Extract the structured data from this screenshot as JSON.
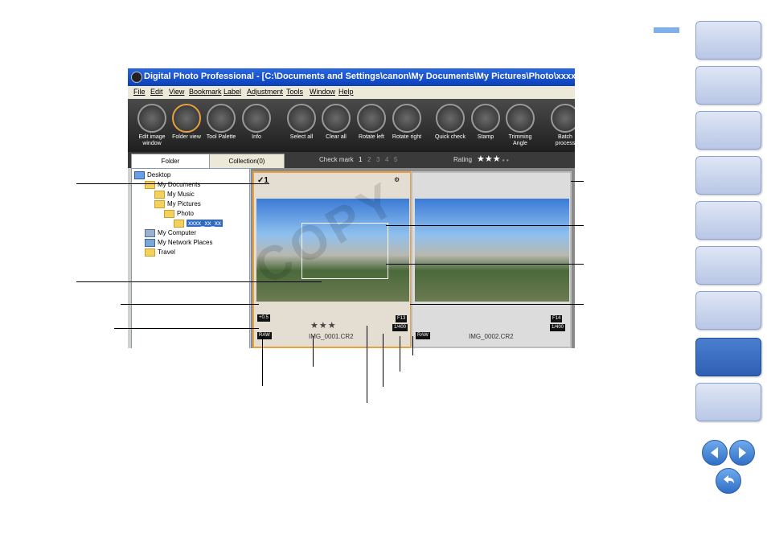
{
  "window": {
    "title": "Digital Photo Professional - [C:\\Documents and Settings\\canon\\My Documents\\My Pictures\\Photo\\xxxx_xx_xx]"
  },
  "menu": [
    "File",
    "Edit",
    "View",
    "Bookmark",
    "Label",
    "Adjustment",
    "Tools",
    "Window",
    "Help"
  ],
  "toolbar": [
    {
      "label": "Edit image window",
      "icon": "edit-image-icon"
    },
    {
      "label": "Folder view",
      "icon": "folder-view-icon",
      "selected": true
    },
    {
      "label": "Tool Palette",
      "icon": "tool-palette-icon"
    },
    {
      "label": "Info",
      "icon": "info-icon"
    },
    {
      "label": "Select all",
      "icon": "select-all-icon"
    },
    {
      "label": "Clear all",
      "icon": "clear-all-icon"
    },
    {
      "label": "Rotate left",
      "icon": "rotate-left-icon"
    },
    {
      "label": "Rotate right",
      "icon": "rotate-right-icon"
    },
    {
      "label": "Quick check",
      "icon": "quick-check-icon"
    },
    {
      "label": "Stamp",
      "icon": "stamp-icon"
    },
    {
      "label": "Trimming Angle",
      "icon": "trimming-angle-icon"
    },
    {
      "label": "Batch process",
      "icon": "batch-process-icon"
    }
  ],
  "tabs": {
    "folder": "Folder",
    "collection": "Collection(0)"
  },
  "filters": {
    "check_mark_label": "Check mark",
    "rating_label": "Rating",
    "check_marks": [
      "1",
      "2",
      "3",
      "4",
      "5"
    ]
  },
  "tree": [
    {
      "label": "Desktop",
      "indent": 0
    },
    {
      "label": "My Documents",
      "indent": 1
    },
    {
      "label": "My Music",
      "indent": 2
    },
    {
      "label": "My Pictures",
      "indent": 2
    },
    {
      "label": "Photo",
      "indent": 3
    },
    {
      "label": "xxxx_xx_xx",
      "indent": 4,
      "selected": true
    },
    {
      "label": "My Computer",
      "indent": 1
    },
    {
      "label": "My Network Places",
      "indent": 1
    },
    {
      "label": "Travel",
      "indent": 1
    }
  ],
  "thumbnails": [
    {
      "filename": "IMG_0001.CR2",
      "check": "1",
      "aperture": "F13",
      "shutter": "1/400",
      "exposure": "+0.5",
      "format": "RAW",
      "rating_stars": "★★★",
      "selected": true
    },
    {
      "filename": "IMG_0002.CR2",
      "aperture": "F14",
      "shutter": "1/400",
      "format": "RAW",
      "selected": false
    }
  ],
  "watermark": "COPY",
  "colors": {
    "accent": "#e8a040",
    "titlebar": "#0a3fb8",
    "nav_active": "#2e5fb3"
  }
}
